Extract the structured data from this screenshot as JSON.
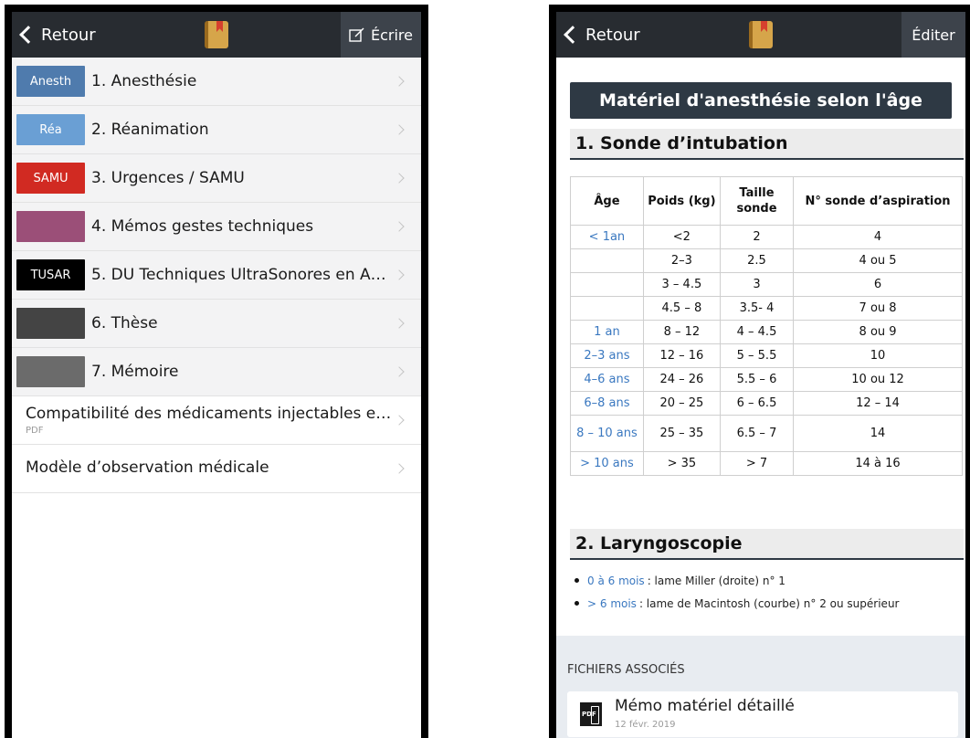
{
  "left": {
    "nav": {
      "back_label": "Retour",
      "action_label": "Écrire"
    },
    "categories": [
      {
        "badge": "Anesth",
        "label": "1. Anesthésie",
        "color": "#4f7bad"
      },
      {
        "badge": "Réa",
        "label": "2. Réanimation",
        "color": "#6a9fd4"
      },
      {
        "badge": "SAMU",
        "label": "3. Urgences / SAMU",
        "color": "#d12a22"
      },
      {
        "badge": "",
        "label": "4. Mémos gestes techniques",
        "color": "#9b4f78"
      },
      {
        "badge": "TUSAR",
        "label": "5. DU Techniques UltraSonores en A…",
        "color": "#000000"
      },
      {
        "badge": "",
        "label": "6. Thèse",
        "color": "#444444"
      },
      {
        "badge": "",
        "label": "7. Mémoire",
        "color": "#6b6b6b"
      }
    ],
    "documents": [
      {
        "title": "Compatibilité des médicaments injectables e…",
        "subtitle": "PDF"
      },
      {
        "title": "Modèle d’observation médicale",
        "subtitle": ""
      }
    ]
  },
  "right": {
    "nav": {
      "back_label": "Retour",
      "action_label": "Éditer"
    },
    "page_title": "Matériel d'anesthésie selon l'âge",
    "section1_title": "1. Sonde d’intubation",
    "table": {
      "headers": [
        "Âge",
        "Poids (kg)",
        "Taille sonde",
        "N° sonde d’aspiration"
      ],
      "rows": [
        [
          "< 1an",
          "<2",
          "2",
          "4"
        ],
        [
          "",
          "2–3",
          "2.5",
          "4 ou 5"
        ],
        [
          "",
          "3 – 4.5",
          "3",
          "6"
        ],
        [
          "",
          "4.5 – 8",
          "3.5- 4",
          "7 ou 8"
        ],
        [
          "1 an",
          "8 – 12",
          "4 – 4.5",
          "8 ou 9"
        ],
        [
          "2–3 ans",
          "12 – 16",
          "5 – 5.5",
          "10"
        ],
        [
          "4–6 ans",
          "24 – 26",
          "5.5 – 6",
          "10 ou 12"
        ],
        [
          "6–8 ans",
          "20 – 25",
          "6 – 6.5",
          "12 – 14"
        ],
        [
          "8 – 10 ans",
          "25 – 35",
          "6.5 – 7",
          "14"
        ],
        [
          "> 10 ans",
          "> 35",
          "> 7",
          "14 à 16"
        ]
      ]
    },
    "section2_title": "2. Laryngoscopie",
    "bullets": [
      {
        "link": "0 à 6 mois",
        "text": ": lame Miller (droite) n° 1"
      },
      {
        "link": "> 6 mois",
        "text": ": lame de Macintosh (courbe) n° 2 ou supérieur"
      }
    ],
    "files_header": "FICHIERS ASSOCIÉS",
    "file": {
      "icon": "pdf-icon",
      "icon_label": "PDF",
      "title": "Mémo matériel détaillé",
      "date": "12 févr. 2019"
    }
  }
}
